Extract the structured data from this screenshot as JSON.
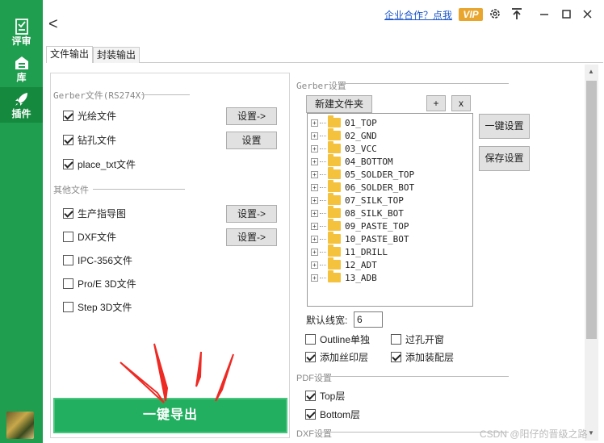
{
  "sidebar": {
    "items": [
      {
        "label": "评审",
        "icon": "checklist-icon"
      },
      {
        "label": "库",
        "icon": "storage-icon"
      },
      {
        "label": "插件",
        "icon": "rocket-icon"
      }
    ]
  },
  "header": {
    "back": "<",
    "link": "企业合作？点我",
    "vip": "VIP"
  },
  "tabs": [
    {
      "label": "文件输出",
      "active": true
    },
    {
      "label": "封装输出",
      "active": false
    }
  ],
  "left": {
    "gerber_group": "Gerber文件(RS274X)",
    "gerber_items": [
      {
        "label": "光绘文件",
        "checked": true,
        "button": "设置->"
      },
      {
        "label": "钻孔文件",
        "checked": true,
        "button": "设置"
      },
      {
        "label": "place_txt文件",
        "checked": true,
        "button": ""
      }
    ],
    "other_group": "其他文件",
    "other_items": [
      {
        "label": "生产指导图",
        "checked": true,
        "button": "设置->"
      },
      {
        "label": "DXF文件",
        "checked": false,
        "button": "设置->"
      },
      {
        "label": "IPC-356文件",
        "checked": false,
        "button": ""
      },
      {
        "label": "Pro/E 3D文件",
        "checked": false,
        "button": ""
      },
      {
        "label": "Step 3D文件",
        "checked": false,
        "button": ""
      }
    ],
    "export_button": "一键导出"
  },
  "right": {
    "gerber_settings_title": "Gerber设置",
    "new_folder": "新建文件夹",
    "add": "+",
    "remove": "x",
    "one_key_setting": "一键设置",
    "save_setting": "保存设置",
    "folders": [
      "01_TOP",
      "02_GND",
      "03_VCC",
      "04_BOTTOM",
      "05_SOLDER_TOP",
      "06_SOLDER_BOT",
      "07_SILK_TOP",
      "08_SILK_BOT",
      "09_PASTE_TOP",
      "10_PASTE_BOT",
      "11_DRILL",
      "12_ADT",
      "13_ADB"
    ],
    "default_linewidth_label": "默认线宽:",
    "default_linewidth_value": "6",
    "options": [
      {
        "label": "Outline单独",
        "checked": false
      },
      {
        "label": "过孔开窗",
        "checked": false
      },
      {
        "label": "添加丝印层",
        "checked": true
      },
      {
        "label": "添加装配层",
        "checked": true
      }
    ],
    "pdf_settings_title": "PDF设置",
    "pdf_options": [
      {
        "label": "Top层",
        "checked": true
      },
      {
        "label": "Bottom层",
        "checked": true
      }
    ],
    "dxf_settings_title": "DXF设置"
  },
  "watermark": "CSDN @阳仔的晋级之路",
  "colors": {
    "rail": "#1e9e4e",
    "export": "#22b060",
    "link": "#1a55c8",
    "vip": "#e9a62f",
    "arrow": "#ee2a24"
  }
}
